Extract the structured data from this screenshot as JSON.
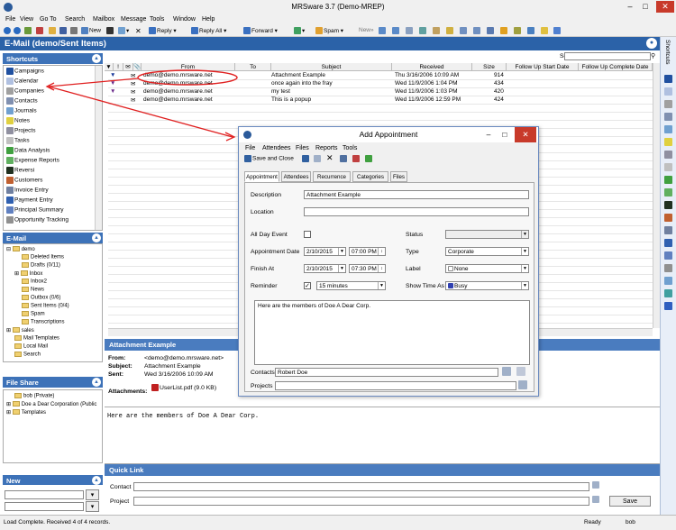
{
  "window": {
    "title": "MRSware 3.7 (Demo-MREP)"
  },
  "menu": [
    "File",
    "View",
    "Go To",
    "Search",
    "Mailbox",
    "Message",
    "Tools",
    "Window",
    "Help"
  ],
  "toolbar": {
    "new": "New",
    "reply": "Reply",
    "reply_all": "Reply All",
    "forward": "Forward",
    "spam": "Spam",
    "new2": "New»"
  },
  "header": {
    "title": "E-Mail (demo/Sent Items)"
  },
  "right_sidebar": {
    "label": "Shortcuts"
  },
  "shortcuts": {
    "title": "Shortcuts",
    "items": [
      "Campaigns",
      "Calendar",
      "Companies",
      "Contacts",
      "Journals",
      "Notes",
      "Projects",
      "Tasks",
      "Data Analysis",
      "Expense Reports",
      "Reversi",
      "Customers",
      "Invoice Entry",
      "Payment Entry",
      "Principal Summary",
      "Opportunity Tracking"
    ]
  },
  "email_panel": {
    "title": "E-Mail",
    "tree": [
      "demo",
      "Deleted Items",
      "Drafts (0/11)",
      "Inbox",
      "Inbox2",
      "News",
      "Outbox (0/6)",
      "Sent Items (0/4)",
      "Spam",
      "Transcriptions",
      "sales",
      "Mail Templates",
      "Local Mail",
      "Search"
    ]
  },
  "file_share": {
    "title": "File Share",
    "items": [
      "bob (Private)",
      "Doe a Dear Corporation (Public",
      "Templates"
    ]
  },
  "new_panel": {
    "title": "New"
  },
  "grid": {
    "search_label": "Search",
    "columns": [
      "!",
      "From",
      "To",
      "Subject",
      "Received",
      "Size",
      "Follow Up Start Date",
      "Follow Up Complete Date"
    ],
    "rows": [
      {
        "from": "demo@demo.mrsware.net",
        "to": "",
        "subject": "Attachment Example",
        "received": "Thu 3/16/2006 10:09 AM",
        "size": "914"
      },
      {
        "from": "demo@demo.mrsware.net",
        "to": "",
        "subject": "once again into the fray",
        "received": "Wed 11/9/2006 1:04 PM",
        "size": "434"
      },
      {
        "from": "demo@demo.mrsware.net",
        "to": "",
        "subject": "my test",
        "received": "Wed 11/9/2006 1:03 PM",
        "size": "420"
      },
      {
        "from": "demo@demo.mrsware.net",
        "to": "",
        "subject": "This is a popup",
        "received": "Wed 11/9/2006 12:59 PM",
        "size": "424"
      }
    ]
  },
  "detail": {
    "title": "Attachment Example",
    "from_label": "From:",
    "from": "<demo@demo.mrsware.net>",
    "subject_label": "Subject:",
    "subject": "Attachment Example",
    "sent_label": "Sent:",
    "sent": "Wed 3/16/2006 10:09 AM",
    "attach_label": "Attachments:",
    "attachment": "UserList.pdf (9.0 KB)"
  },
  "body": {
    "text": "Here are the members of Doe A Dear Corp."
  },
  "quick_link": {
    "title": "Quick Link",
    "contact_label": "Contact",
    "project_label": "Project",
    "save": "Save"
  },
  "status": {
    "left": "Load Complete.  Received 4 of 4 records.",
    "ready": "Ready",
    "user": "bob"
  },
  "dialog": {
    "title": "Add Appointment",
    "menu": [
      "File",
      "Attendees",
      "Files",
      "Reports",
      "Tools"
    ],
    "save_close": "Save and Close",
    "tabs": [
      "Appointment",
      "Attendees",
      "Recurrence",
      "Categories",
      "Files"
    ],
    "description_label": "Description",
    "description": "Attachment Example",
    "location_label": "Location",
    "location": "",
    "all_day_label": "All Day Event",
    "status_label": "Status",
    "status": "",
    "appt_date_label": "Appointment Date",
    "appt_date": "2/10/2015",
    "appt_time": "07:00 PM",
    "type_label": "Type",
    "type": "Corporate",
    "finish_label": "Finish At",
    "finish_date": "2/10/2015",
    "finish_time": "07:30 PM",
    "label_label": "Label",
    "label": "None",
    "reminder_label": "Reminder",
    "reminder": "15 minutes",
    "show_time_label": "Show Time As",
    "show_time": "Busy",
    "notes": "Here are the members of Doe A Dear Corp.",
    "contacts_label": "Contacts",
    "contacts": "Robert Doe",
    "projects_label": "Projects",
    "projects": ""
  }
}
